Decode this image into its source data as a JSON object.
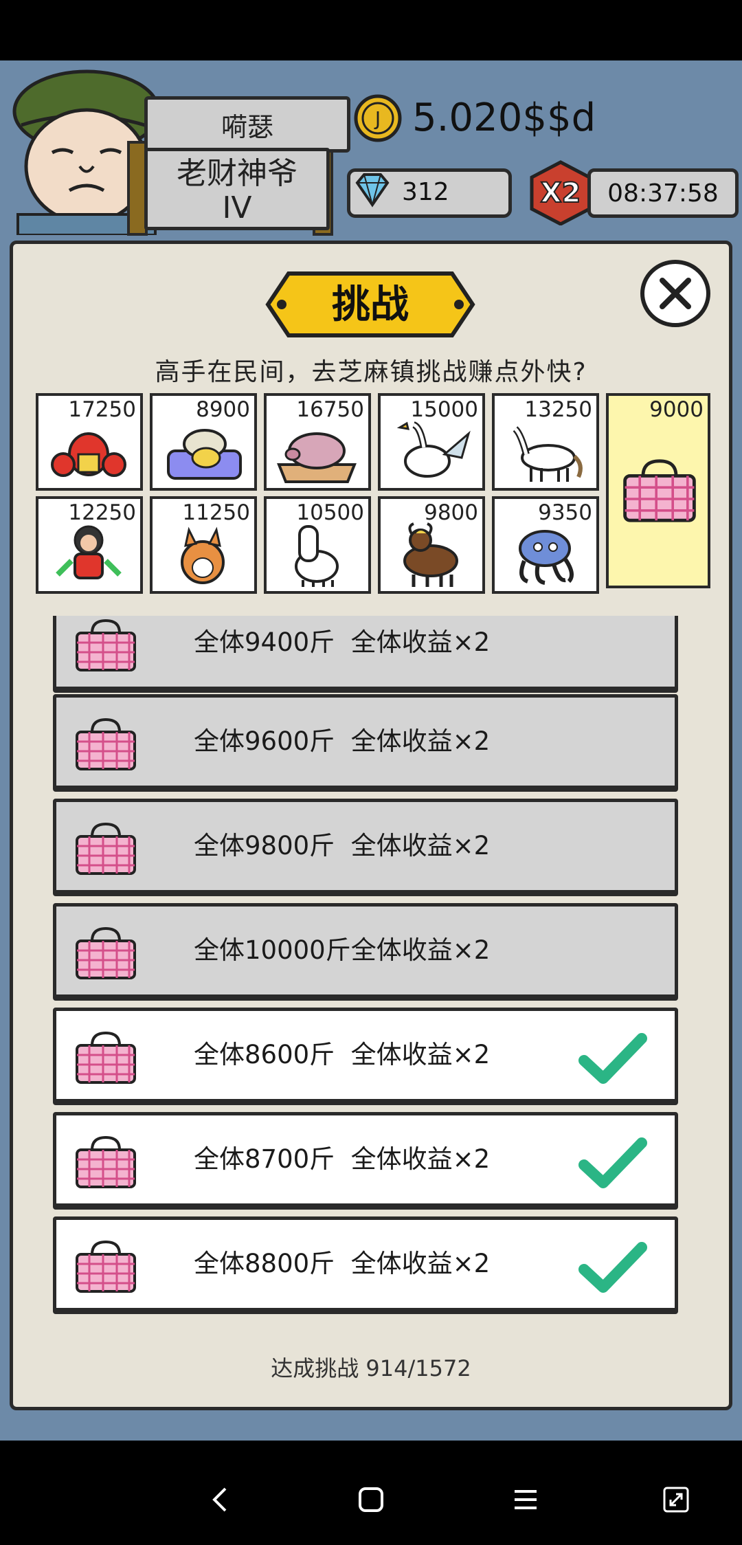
{
  "hud": {
    "player_name": "嗬瑟",
    "rank_line1": "老财神爷",
    "rank_line2": "IV",
    "coins": "5.020$$d",
    "gems": "312",
    "multiplier": "X2",
    "timer": "08:37:58"
  },
  "panel": {
    "title": "挑战",
    "subtitle": "高手在民间，去芝麻镇挑战赚点外快?",
    "grid": [
      {
        "value": "17250",
        "icon": "lobster-icon"
      },
      {
        "value": "8900",
        "icon": "fish-on-sofa-icon"
      },
      {
        "value": "16750",
        "icon": "pig-icon"
      },
      {
        "value": "15000",
        "icon": "goose-icon"
      },
      {
        "value": "13250",
        "icon": "white-horse-icon"
      },
      {
        "value": "9000",
        "icon": "plaid-bag-icon",
        "selected": true
      },
      {
        "value": "12250",
        "icon": "monkey-icon"
      },
      {
        "value": "11250",
        "icon": "shiba-dog-icon"
      },
      {
        "value": "10500",
        "icon": "alpaca-icon"
      },
      {
        "value": "9800",
        "icon": "yak-icon"
      },
      {
        "value": "9350",
        "icon": "octopus-icon"
      }
    ],
    "rows": [
      {
        "text": "全体9400斤  全体收益×2",
        "done": false
      },
      {
        "text": "全体9600斤  全体收益×2",
        "done": false
      },
      {
        "text": "全体9800斤  全体收益×2",
        "done": false
      },
      {
        "text": "全体10000斤全体收益×2",
        "done": false
      },
      {
        "text": "全体8600斤  全体收益×2",
        "done": true
      },
      {
        "text": "全体8700斤  全体收益×2",
        "done": true
      },
      {
        "text": "全体8800斤  全体收益×2",
        "done": true
      }
    ],
    "progress": "达成挑战 914/1572"
  },
  "colors": {
    "panel_bg": "#e7e3d7",
    "banner_yellow": "#f5c518",
    "check_green": "#2bb585",
    "bag_pink": "#e56aa0"
  }
}
